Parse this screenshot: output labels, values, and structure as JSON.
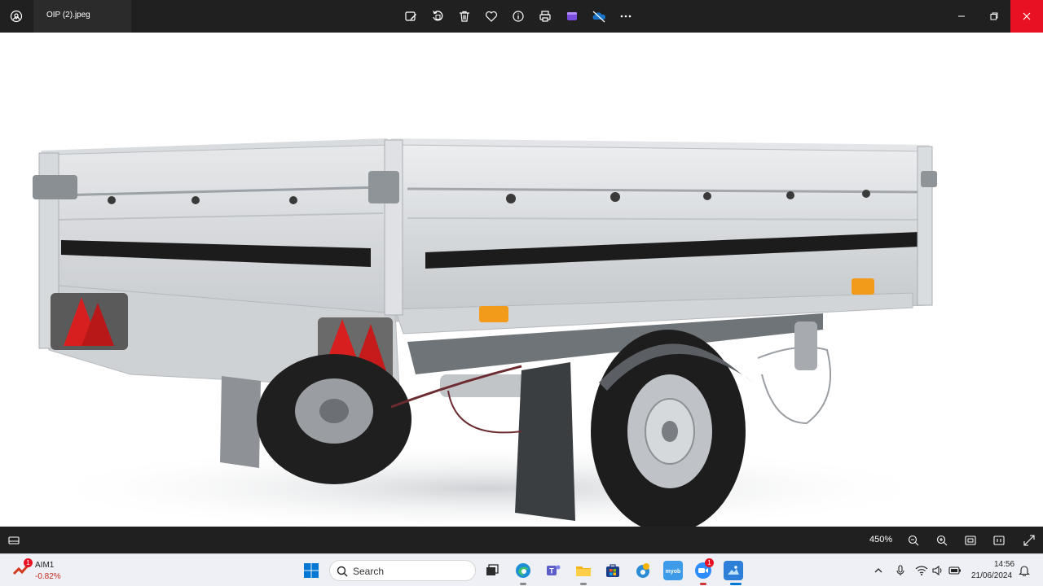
{
  "window": {
    "file_name": "OIP (2).jpeg",
    "toolbar": [
      "edit-image-icon",
      "rotate-icon",
      "delete-icon",
      "favorite-icon",
      "info-icon",
      "print-icon",
      "clipchamp-icon",
      "onedrive-icon",
      "more-icon"
    ],
    "controls": [
      "minimize-icon",
      "restore-icon",
      "close-icon"
    ]
  },
  "status_bar": {
    "zoom_level": "450%",
    "buttons": [
      "filmstrip-icon",
      "zoom-out-icon",
      "zoom-in-icon",
      "fit-to-window-icon",
      "actual-size-icon",
      "full-screen-icon"
    ]
  },
  "taskbar": {
    "stock_widget": {
      "name": "AIM1",
      "change": "-0.82%",
      "badge": "1"
    },
    "search_placeholder": "Search",
    "apps": [
      "windows-start-icon",
      "task-view-icon",
      "edge-icon",
      "teams-icon",
      "file-explorer-icon",
      "microsoft-store-icon",
      "edge-dev-icon",
      "myob-icon",
      "zoom-icon",
      "photos-icon"
    ],
    "zoom_badge": "1",
    "tray": [
      "show-hidden-icons-icon",
      "microphone-icon",
      "wifi-icon",
      "volume-icon",
      "battery-icon",
      "notifications-icon"
    ],
    "time": "14:56",
    "date": "21/06/2024"
  },
  "colors": {
    "titlebar": "#202020",
    "close": "#e81123",
    "taskbar": "#eef0f5",
    "trailer_red": "#d71f1f"
  }
}
